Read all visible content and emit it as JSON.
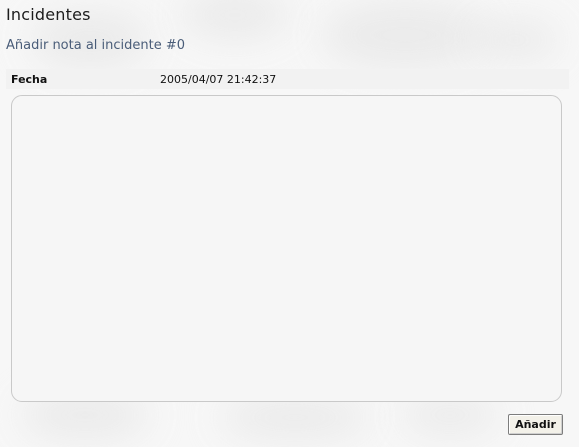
{
  "page": {
    "title": "Incidentes",
    "subtitle": "Añadir nota al incidente #0"
  },
  "form": {
    "fecha_label": "Fecha",
    "fecha_value": "2005/04/07 21:42:37",
    "note_value": "",
    "submit_label": "Añadir"
  }
}
